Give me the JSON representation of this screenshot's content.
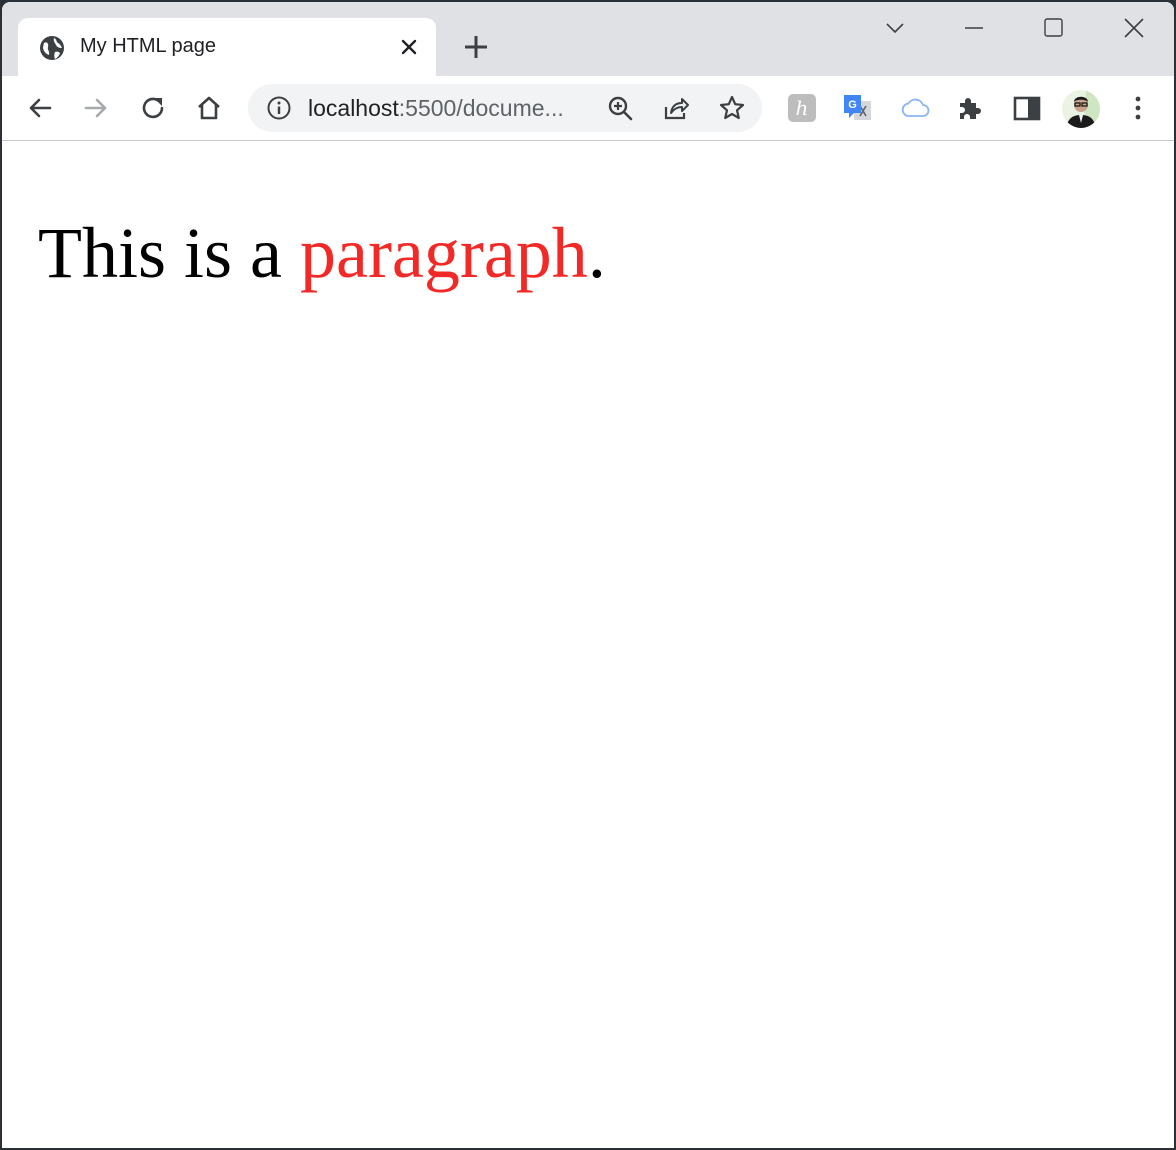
{
  "browser": {
    "tab": {
      "title": "My HTML page",
      "favicon": "globe-icon"
    },
    "window_controls": [
      "tab-search-icon",
      "minimize-icon",
      "maximize-icon",
      "close-icon"
    ],
    "omnibox": {
      "url_host": "localhost",
      "url_path": ":5500/docume..."
    },
    "toolbar_icons": [
      "back-icon",
      "forward-icon",
      "reload-icon",
      "home-icon",
      "zoom-icon",
      "share-icon",
      "bookmark-star-icon",
      "ext-h-icon",
      "translate-icon",
      "cloud-icon",
      "extensions-icon",
      "side-panel-icon",
      "avatar",
      "menu-icon"
    ],
    "extensions": {
      "h_badge": "h"
    }
  },
  "page": {
    "paragraph_before": "This is a ",
    "paragraph_highlight": "paragraph",
    "paragraph_after": ".",
    "highlight_color": "#f22a27"
  }
}
